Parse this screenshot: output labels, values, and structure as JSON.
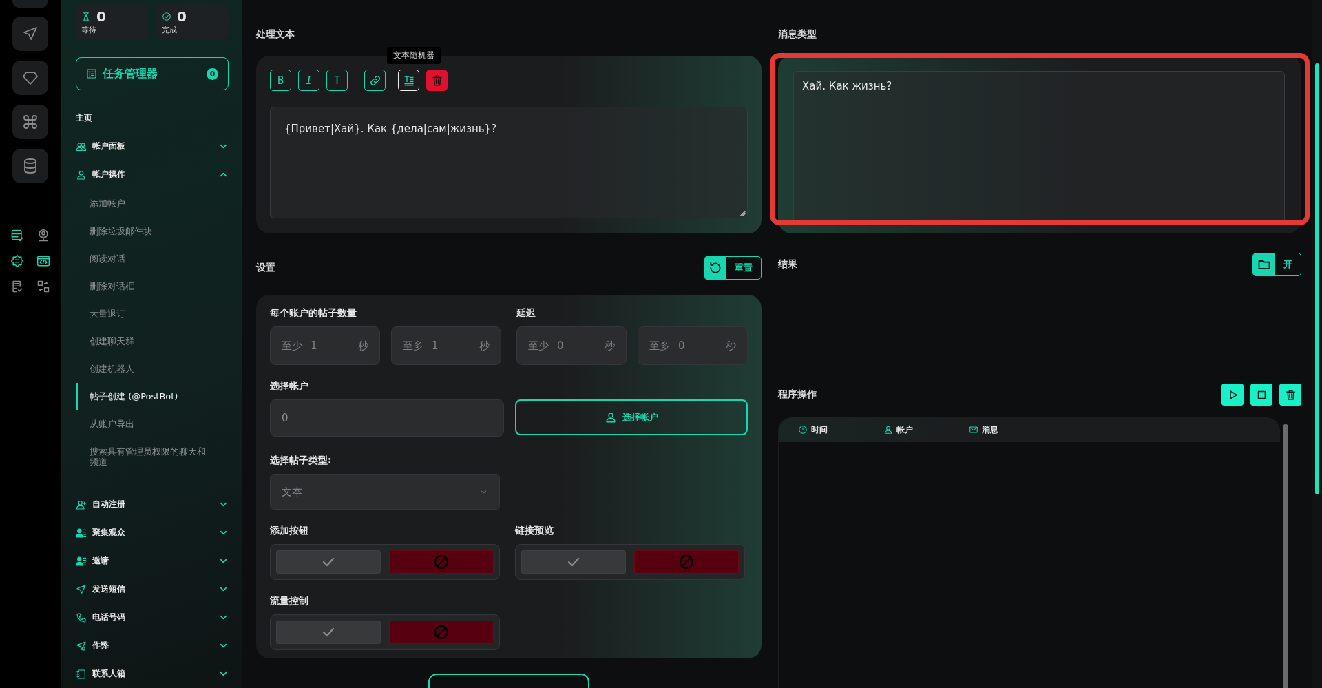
{
  "rail": {
    "buttons": [
      {
        "kind": "send"
      },
      {
        "kind": "diamond"
      },
      {
        "kind": "command"
      },
      {
        "kind": "database"
      }
    ],
    "tools": [
      {
        "kind": "list-check",
        "active": true
      },
      {
        "kind": "user-pin",
        "active": false
      },
      {
        "kind": "gear",
        "active": true
      },
      {
        "kind": "code",
        "active": true
      },
      {
        "kind": "doc-check",
        "active": false
      },
      {
        "kind": "swap",
        "active": false
      }
    ]
  },
  "stats": [
    {
      "kind": "hourglass",
      "value": "0",
      "label": "等待"
    },
    {
      "kind": "check",
      "value": "0",
      "label": "完成"
    }
  ],
  "task_manager": {
    "label": "任务管理器",
    "count": "0"
  },
  "menu_heading": "主页",
  "menu": [
    {
      "kind": "users",
      "label": "帐户面板",
      "expanded": false
    },
    {
      "kind": "user",
      "label": "帐户操作",
      "expanded": true,
      "children": [
        {
          "label": "添加帐户",
          "selected": false
        },
        {
          "label": "删除垃圾邮件块",
          "selected": false
        },
        {
          "label": "阅读对话",
          "selected": false
        },
        {
          "label": "删除对话框",
          "selected": false
        },
        {
          "label": "大量退订",
          "selected": false
        },
        {
          "label": "创建聊天群",
          "selected": false
        },
        {
          "label": "创建机器人",
          "selected": false
        },
        {
          "label": "帖子创建 (@PostBot)",
          "selected": true
        },
        {
          "label": "从账户导出",
          "selected": false
        },
        {
          "label": "搜索具有管理员权限的聊天和频道",
          "selected": false
        }
      ]
    },
    {
      "kind": "user-plus",
      "label": "自动注册",
      "expanded": false
    },
    {
      "kind": "user-list",
      "label": "聚集观众",
      "expanded": false
    },
    {
      "kind": "user-list",
      "label": "邀请",
      "expanded": false
    },
    {
      "kind": "send",
      "label": "发送短信",
      "expanded": false
    },
    {
      "kind": "phone",
      "label": "电话号码",
      "expanded": false
    },
    {
      "kind": "send-gear",
      "label": "作弊",
      "expanded": false
    },
    {
      "kind": "book",
      "label": "联系人箱",
      "expanded": false
    }
  ],
  "text_panel": {
    "title": "处理文本",
    "toolbar": [
      {
        "kind": "bold",
        "label": "B"
      },
      {
        "kind": "italic",
        "label": "I"
      },
      {
        "kind": "text",
        "label": "T"
      },
      {
        "kind": "link"
      },
      {
        "kind": "randomizer",
        "hovered": true
      },
      {
        "kind": "delete"
      }
    ],
    "tooltip": "文本随机器",
    "value": "{Привет|Хай}. Как {дела|сам|жизнь}?"
  },
  "preview_panel": {
    "title": "消息类型",
    "value": "Хай. Как жизнь?",
    "highlighted": true
  },
  "settings": {
    "title": "设置",
    "reset_label": "重置",
    "posts_per_account": {
      "label": "每个账户的帖子数量",
      "fields": [
        {
          "prefix": "至少",
          "value": "1",
          "unit": "秒"
        },
        {
          "prefix": "至多",
          "value": "1",
          "unit": "秒"
        }
      ]
    },
    "delay": {
      "label": "延迟",
      "fields": [
        {
          "prefix": "至少",
          "value": "0",
          "unit": "秒"
        },
        {
          "prefix": "至多",
          "value": "0",
          "unit": "秒"
        }
      ]
    },
    "select_accounts": {
      "label": "选择帐户",
      "value": "0",
      "button": "选择帐户"
    },
    "post_type": {
      "label": "选择帖子类型:",
      "value": "文本"
    },
    "toggles": [
      {
        "label": "添加按钮",
        "on": false
      },
      {
        "label": "链接预览",
        "on": false
      },
      {
        "label": "流量控制",
        "on": false
      }
    ]
  },
  "results": {
    "title": "结果",
    "open_label": "开"
  },
  "operations": {
    "title": "程序操作",
    "buttons": [
      {
        "kind": "play"
      },
      {
        "kind": "stop"
      },
      {
        "kind": "delete"
      }
    ],
    "columns": [
      {
        "kind": "clock",
        "label": "时间"
      },
      {
        "kind": "user",
        "label": "帐户"
      },
      {
        "kind": "mail",
        "label": "消息"
      }
    ]
  }
}
